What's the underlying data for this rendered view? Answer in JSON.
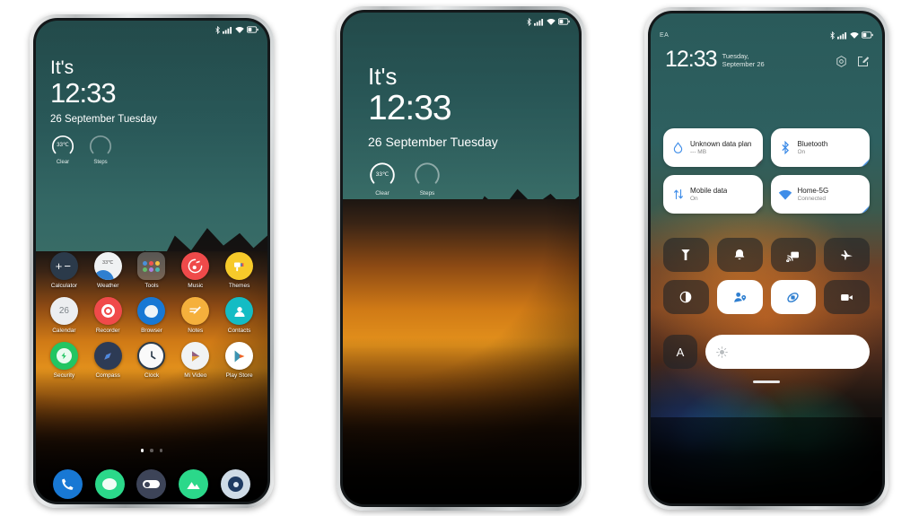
{
  "meta": {
    "accent_blue": "#3f8de8",
    "wallpaper_sky": "#2d6060",
    "wallpaper_mountain": "#d07a16"
  },
  "status_bar": {
    "carrier": "EA",
    "icons": [
      "bluetooth-icon",
      "signal-icon",
      "wifi-icon",
      "battery-icon"
    ],
    "recording_dot": "recording-dot"
  },
  "lockscreen": {
    "greeting": "It's",
    "time": "12:33",
    "date": "26 September Tuesday",
    "widgets": [
      {
        "value": "33℃",
        "label": "Clear",
        "name": "weather-ring"
      },
      {
        "value": "",
        "label": "Steps",
        "name": "steps-ring"
      }
    ]
  },
  "homescreen": {
    "apps": [
      {
        "label": "Calculator",
        "icon": "calculator-icon"
      },
      {
        "label": "Weather",
        "icon": "weather-icon",
        "value": "33℃"
      },
      {
        "label": "Tools",
        "icon": "tools-folder-icon"
      },
      {
        "label": "Music",
        "icon": "music-icon"
      },
      {
        "label": "Themes",
        "icon": "themes-icon"
      },
      {
        "label": "Calendar",
        "icon": "calendar-icon",
        "value": "26"
      },
      {
        "label": "Recorder",
        "icon": "recorder-icon"
      },
      {
        "label": "Browser",
        "icon": "browser-icon"
      },
      {
        "label": "Notes",
        "icon": "notes-icon"
      },
      {
        "label": "Contacts",
        "icon": "contacts-icon"
      },
      {
        "label": "Security",
        "icon": "security-icon"
      },
      {
        "label": "Compass",
        "icon": "compass-icon"
      },
      {
        "label": "Clock",
        "icon": "clock-icon"
      },
      {
        "label": "Mi Video",
        "icon": "mi-video-icon"
      },
      {
        "label": "Play Store",
        "icon": "play-store-icon"
      }
    ],
    "page_dots": {
      "count": 3,
      "active_index": 0
    },
    "dock": [
      {
        "label": "Phone",
        "icon": "phone-icon"
      },
      {
        "label": "Messages",
        "icon": "messages-icon"
      },
      {
        "label": "Settings",
        "icon": "settings-icon"
      },
      {
        "label": "Gallery",
        "icon": "gallery-icon"
      },
      {
        "label": "Camera",
        "icon": "camera-icon"
      }
    ]
  },
  "control_center": {
    "time": "12:33",
    "date": "Tuesday, September 26",
    "actions": [
      {
        "name": "settings-gear-icon"
      },
      {
        "name": "edit-icon"
      }
    ],
    "big_tiles": [
      {
        "title": "Unknown data plan",
        "subtitle": "--- MB",
        "icon": "data-usage-icon",
        "active": false
      },
      {
        "title": "Bluetooth",
        "subtitle": "On",
        "icon": "bluetooth-icon",
        "active": true
      },
      {
        "title": "Mobile data",
        "subtitle": "On",
        "icon": "mobile-data-icon",
        "active": true
      },
      {
        "title": "Home-5G",
        "subtitle": "Connected",
        "icon": "wifi-icon",
        "active": true
      }
    ],
    "toggles": [
      {
        "name": "flashlight-toggle",
        "icon": "flashlight-icon",
        "on": false
      },
      {
        "name": "ringer-toggle",
        "icon": "bell-icon",
        "on": false
      },
      {
        "name": "cast-toggle",
        "icon": "cast-icon",
        "on": false
      },
      {
        "name": "airplane-mode-toggle",
        "icon": "airplane-icon",
        "on": false
      },
      {
        "name": "dark-mode-toggle",
        "icon": "dark-mode-icon",
        "on": false
      },
      {
        "name": "location-toggle",
        "icon": "location-icon",
        "on": true
      },
      {
        "name": "auto-rotate-toggle",
        "icon": "auto-rotate-icon",
        "on": true
      },
      {
        "name": "screen-record-toggle",
        "icon": "video-camera-icon",
        "on": false
      }
    ],
    "brightness": {
      "auto_label": "A",
      "icon": "sun-icon",
      "level": 100
    }
  }
}
